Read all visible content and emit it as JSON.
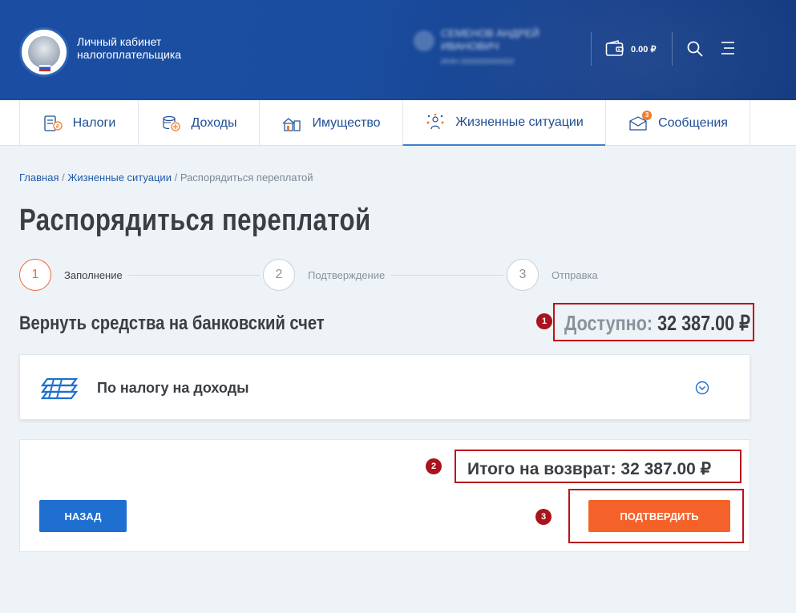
{
  "header": {
    "app_title": "Личный кабинет налогоплательщика",
    "user_name": "СЕМЕНОВ АНДРЕЙ ИВАНОВИЧ",
    "user_sub": "ИНН 000000000000",
    "balance": "0.00 ₽"
  },
  "nav": {
    "items": [
      {
        "label": "Налоги",
        "icon": "taxes-icon"
      },
      {
        "label": "Доходы",
        "icon": "income-icon"
      },
      {
        "label": "Имущество",
        "icon": "property-icon"
      },
      {
        "label": "Жизненные ситуации",
        "icon": "life-situations-icon"
      },
      {
        "label": "Сообщения",
        "icon": "messages-icon",
        "badge": "3"
      }
    ],
    "active_index": 3
  },
  "breadcrumb": {
    "home": "Главная",
    "section": "Жизненные ситуации",
    "current": "Распорядиться переплатой",
    "separator": "/"
  },
  "page": {
    "title": "Распорядиться переплатой",
    "steps": [
      {
        "number": "1",
        "label": "Заполнение",
        "active": true
      },
      {
        "number": "2",
        "label": "Подтверждение",
        "active": false
      },
      {
        "number": "3",
        "label": "Отправка",
        "active": false
      }
    ],
    "section_title": "Вернуть средства на банковский счет",
    "available_label": "Доступно:",
    "available_value": "32 387.00 ₽",
    "card_title": "По налогу на доходы",
    "total_text": "Итого на возврат: 32 387.00 ₽",
    "back_label": "НАЗАД",
    "confirm_label": "ПОДТВЕРДИТЬ",
    "markers": [
      "1",
      "2",
      "3"
    ]
  },
  "colors": {
    "header_bg": "#1b4ea3",
    "accent_orange": "#f4622a",
    "primary_blue": "#1e6fd0",
    "annotation_red": "#b9141b",
    "page_bg": "#eef3f7"
  }
}
